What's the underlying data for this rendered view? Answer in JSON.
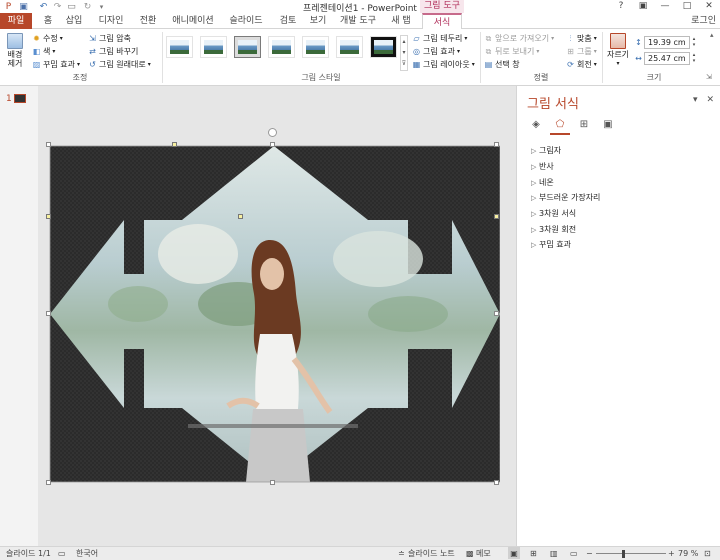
{
  "titlebar": {
    "title": "프레젠테이션1 - PowerPoint",
    "context_group": "그림 도구",
    "window_buttons": [
      "?",
      "▣",
      "—",
      "□",
      "✕"
    ]
  },
  "tabs": [
    {
      "label": "파일"
    },
    {
      "label": "홈"
    },
    {
      "label": "삽입"
    },
    {
      "label": "디자인"
    },
    {
      "label": "전환"
    },
    {
      "label": "애니메이션"
    },
    {
      "label": "슬라이드 쇼"
    },
    {
      "label": "검토"
    },
    {
      "label": "보기"
    },
    {
      "label": "개발 도구"
    },
    {
      "label": "새 탭"
    },
    {
      "label": "서식"
    }
  ],
  "account": "로그인",
  "ribbon": {
    "adjust": {
      "remove_bg": "배경\n제거",
      "corrections": "수정",
      "color": "색",
      "artistic": "꾸밈 효과",
      "compress": "그림 압축",
      "change": "그림 바꾸기",
      "reset": "그림 원래대로",
      "label": "조정"
    },
    "styles": {
      "label": "그림 스타일",
      "border": "그림 테두리",
      "effects": "그림 효과",
      "layout": "그림 레이아웃"
    },
    "arrange": {
      "bring_forward": "앞으로 가져오기",
      "send_backward": "뒤로 보내기",
      "selection_pane": "선택 창",
      "align": "맞춤",
      "group": "그룹",
      "rotate": "회전",
      "label": "정렬"
    },
    "size": {
      "crop": "자르기",
      "height": "19.39 cm",
      "width": "25.47 cm",
      "label": "크기"
    }
  },
  "thumbs": {
    "slide_number": "1"
  },
  "pane": {
    "title": "그림 서식",
    "sections": [
      "그림자",
      "반사",
      "네온",
      "부드러운 가장자리",
      "3차원 서식",
      "3차원 회전",
      "꾸밈 효과"
    ]
  },
  "status": {
    "slide": "슬라이드 1/1",
    "language": "한국어",
    "notes": "슬라이드 노트",
    "memo": "메모",
    "zoom": "79 %",
    "zoom_level": 0.79
  },
  "colors": {
    "accent": "#b7472a",
    "context": "#b02e5a",
    "slide_bg": "#2a2a2a"
  }
}
